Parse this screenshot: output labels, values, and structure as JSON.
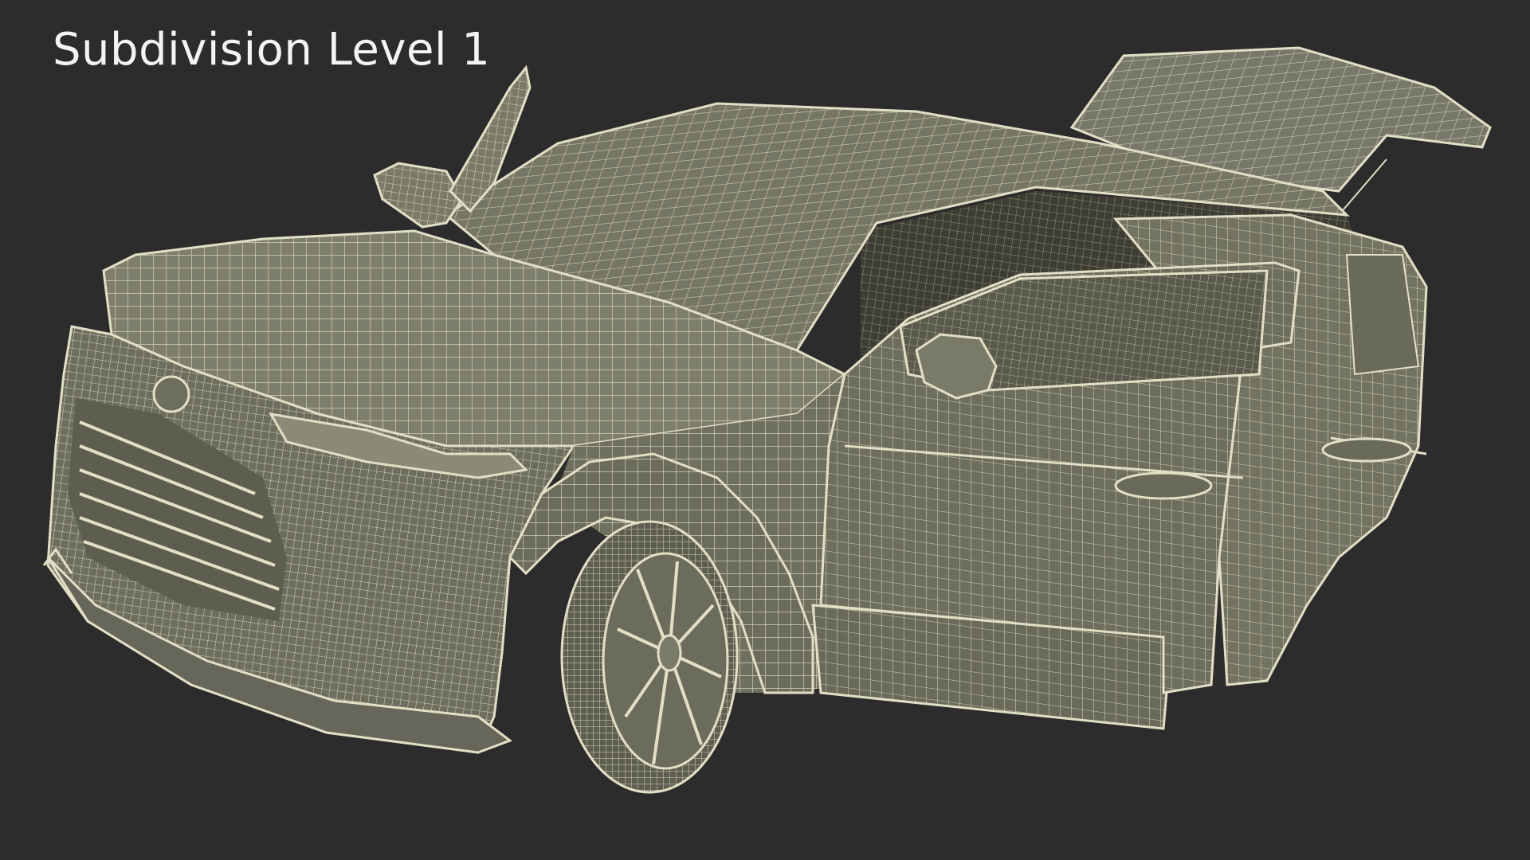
{
  "caption": "Subdivision Level 1",
  "colors": {
    "background": "#2c2c2c",
    "surface": "#727260",
    "surface_dark": "#5c5c4c",
    "surface_light": "#8c8c78",
    "wire": "#e2dfc6",
    "caption_text": "#f4f4f4"
  }
}
